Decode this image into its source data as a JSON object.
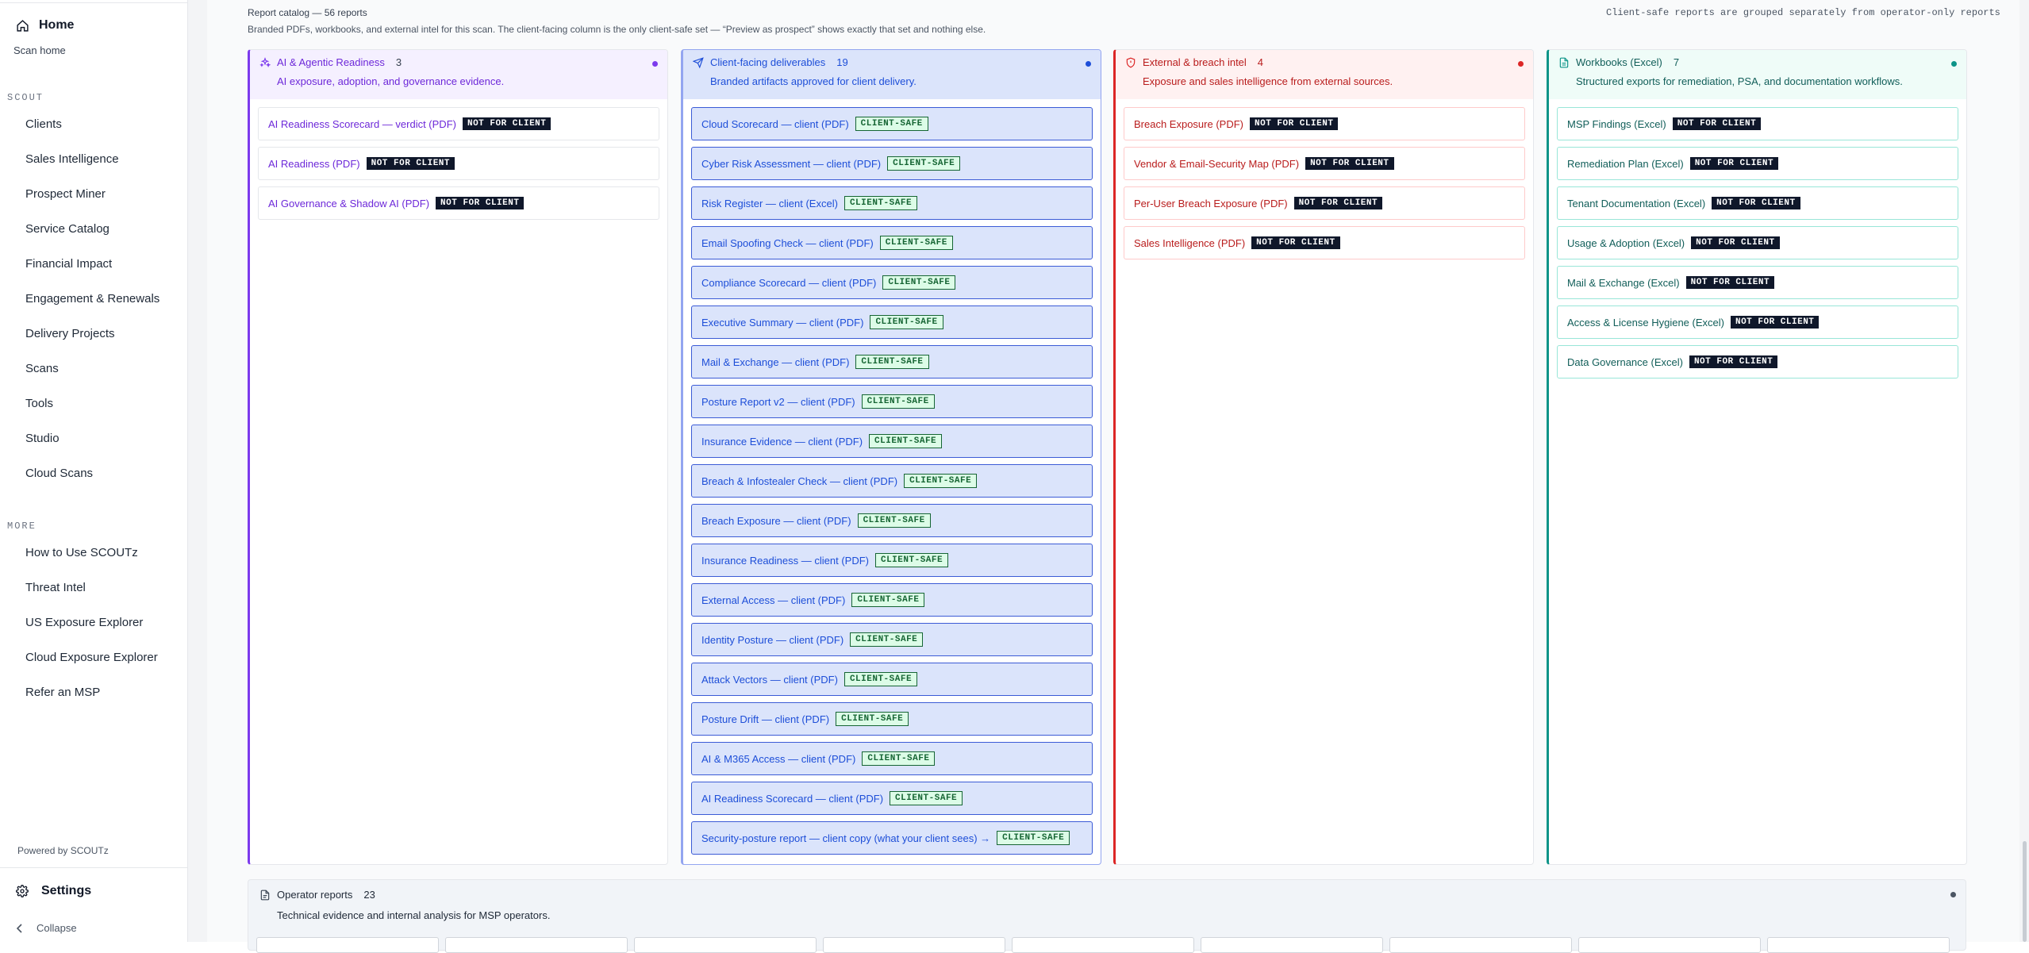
{
  "sidebar": {
    "home_label": "Home",
    "scan_home": "Scan home",
    "section_scout": "SCOUT",
    "scout_items": [
      "Clients",
      "Sales Intelligence",
      "Prospect Miner",
      "Service Catalog",
      "Financial Impact",
      "Engagement & Renewals",
      "Delivery Projects",
      "Scans",
      "Tools",
      "Studio",
      "Cloud Scans"
    ],
    "section_more": "MORE",
    "more_items": [
      "How to Use SCOUTz",
      "Threat Intel",
      "US Exposure Explorer",
      "Cloud Exposure Explorer",
      "Refer an MSP"
    ],
    "powered": "Powered by SCOUTz",
    "settings": "Settings",
    "collapse": "Collapse"
  },
  "header": {
    "title": "Report catalog — 56 reports",
    "subtitle": "Branded PDFs, workbooks, and external intel for this scan. The client-facing column is the only client-safe set — “Preview as prospect” shows exactly that set and nothing else.",
    "right_note": "Client-safe reports are grouped separately from operator-only reports"
  },
  "badges": {
    "not_for_client": "NOT FOR CLIENT",
    "client_safe": "CLIENT-SAFE"
  },
  "columns": {
    "ai": {
      "title": "AI & Agentic Readiness",
      "count": "3",
      "desc": "AI exposure, adoption, and governance evidence.",
      "items": [
        "AI Readiness Scorecard — verdict (PDF)",
        "AI Readiness (PDF)",
        "AI Governance & Shadow AI (PDF)"
      ]
    },
    "cf": {
      "title": "Client-facing deliverables",
      "count": "19",
      "desc": "Branded artifacts approved for client delivery.",
      "items": [
        "Cloud Scorecard — client (PDF)",
        "Cyber Risk Assessment — client (PDF)",
        "Risk Register — client (Excel)",
        "Email Spoofing Check — client (PDF)",
        "Compliance Scorecard — client (PDF)",
        "Executive Summary — client (PDF)",
        "Mail & Exchange — client (PDF)",
        "Posture Report v2 — client (PDF)",
        "Insurance Evidence — client (PDF)",
        "Breach & Infostealer Check — client (PDF)",
        "Breach Exposure — client (PDF)",
        "Insurance Readiness — client (PDF)",
        "External Access — client (PDF)",
        "Identity Posture — client (PDF)",
        "Attack Vectors — client (PDF)",
        "Posture Drift — client (PDF)",
        "AI & M365 Access — client (PDF)",
        "AI Readiness Scorecard — client (PDF)",
        "Security-posture report — client copy (what your client sees) →"
      ]
    },
    "ex": {
      "title": "External & breach intel",
      "count": "4",
      "desc": "Exposure and sales intelligence from external sources.",
      "items": [
        "Breach Exposure (PDF)",
        "Vendor & Email-Security Map (PDF)",
        "Per-User Breach Exposure (PDF)",
        "Sales Intelligence (PDF)"
      ]
    },
    "wb": {
      "title": "Workbooks (Excel)",
      "count": "7",
      "desc": "Structured exports for remediation, PSA, and documentation workflows.",
      "items": [
        "MSP Findings (Excel)",
        "Remediation Plan (Excel)",
        "Tenant Documentation (Excel)",
        "Usage & Adoption (Excel)",
        "Mail & Exchange (Excel)",
        "Access & License Hygiene (Excel)",
        "Data Governance (Excel)"
      ]
    }
  },
  "operator": {
    "title": "Operator reports",
    "count": "23",
    "desc": "Technical evidence and internal analysis for MSP operators."
  },
  "colors": {
    "ai": "#7c3aed",
    "cf": "#1d4ed8",
    "ex": "#dc2626",
    "wb": "#0d9488"
  }
}
